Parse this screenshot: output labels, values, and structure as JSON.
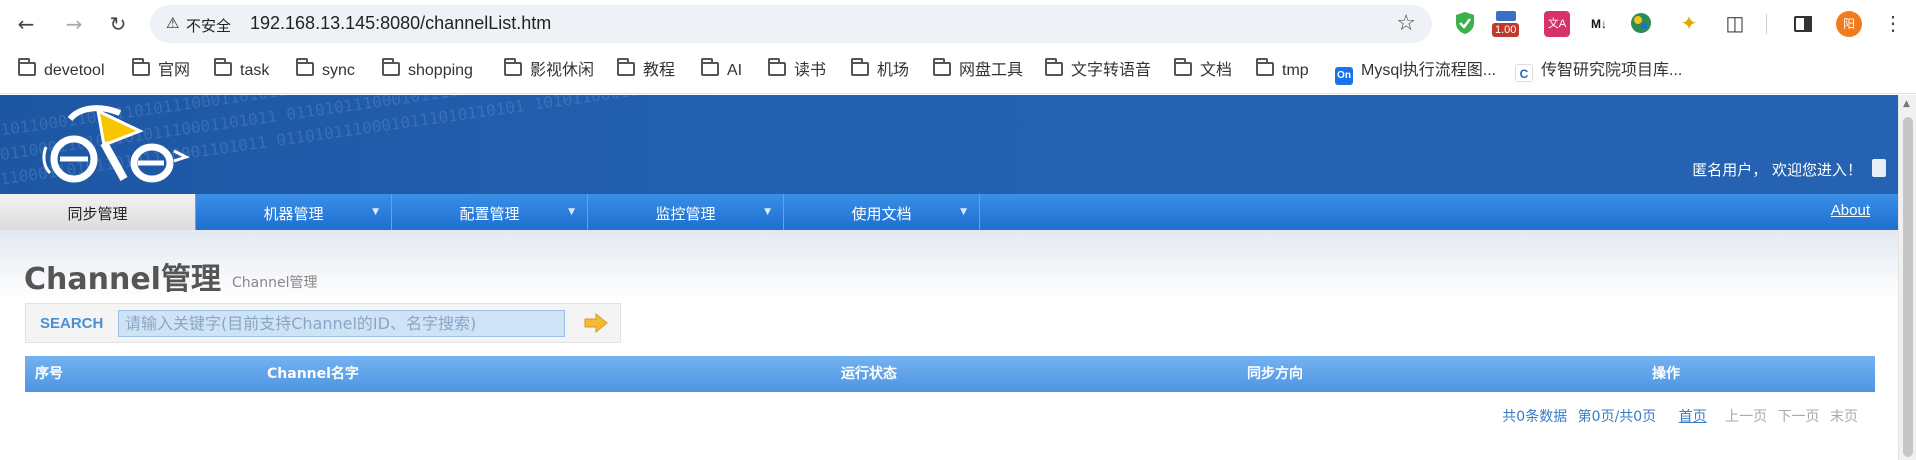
{
  "browser": {
    "insecure_label": "不安全",
    "url": "192.168.13.145:8080/channelList.htm",
    "ext_badge": "1.00",
    "profile_initial": "阳"
  },
  "bookmarks": [
    {
      "label": "devetool",
      "type": "folder"
    },
    {
      "label": "官网",
      "type": "folder"
    },
    {
      "label": "task",
      "type": "folder"
    },
    {
      "label": "sync",
      "type": "folder"
    },
    {
      "label": "shopping",
      "type": "folder"
    },
    {
      "label": "影视休闲",
      "type": "folder"
    },
    {
      "label": "教程",
      "type": "folder"
    },
    {
      "label": "AI",
      "type": "folder"
    },
    {
      "label": "读书",
      "type": "folder"
    },
    {
      "label": "机场",
      "type": "folder"
    },
    {
      "label": "网盘工具",
      "type": "folder"
    },
    {
      "label": "文字转语音",
      "type": "folder"
    },
    {
      "label": "文档",
      "type": "folder"
    },
    {
      "label": "tmp",
      "type": "folder"
    },
    {
      "label": "Mysql执行流程图...",
      "type": "site",
      "icon_text": "On",
      "icon_color": "#1a73e8"
    },
    {
      "label": "传智研究院项目库...",
      "type": "site",
      "icon_text": "C",
      "icon_color": "#ffffff"
    }
  ],
  "header": {
    "welcome": "匿名用户， 欢迎您进入！",
    "binary_text": "0101100011010110101110001101011 01101011100010111010110101 1010110001110101101101100011 01011000111010110101110001101"
  },
  "nav": {
    "items": [
      {
        "label": "同步管理",
        "active": true
      },
      {
        "label": "机器管理",
        "active": false
      },
      {
        "label": "配置管理",
        "active": false
      },
      {
        "label": "监控管理",
        "active": false
      },
      {
        "label": "使用文档",
        "active": false
      }
    ],
    "about": "About"
  },
  "page": {
    "title": "Channel管理",
    "subtitle": "Channel管理"
  },
  "search": {
    "label": "SEARCH",
    "placeholder": "请输入关键字(目前支持Channel的ID、名字搜索)"
  },
  "table": {
    "columns": [
      "序号",
      "Channel名字",
      "运行状态",
      "同步方向",
      "操作"
    ]
  },
  "pager": {
    "total": "共0条数据",
    "page_info": "第0页/共0页",
    "first": "首页",
    "prev": "上一页",
    "next": "下一页",
    "last": "末页"
  },
  "colors": {
    "header_blue": "#2360b0",
    "nav_blue": "#1e6fd0",
    "grid_head": "#4e95e2",
    "link_blue": "#3a7bc8"
  }
}
